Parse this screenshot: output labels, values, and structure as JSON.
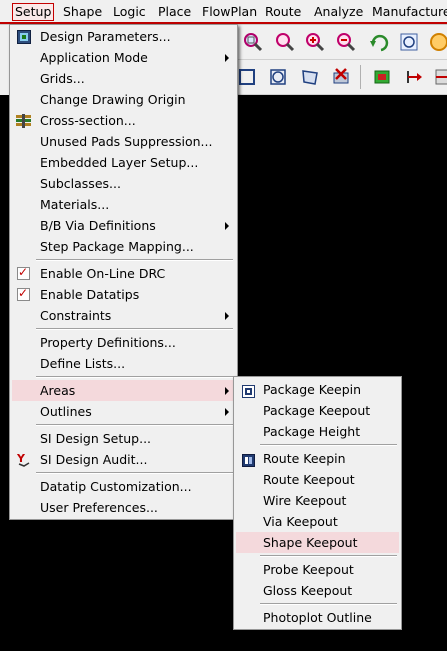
{
  "menubar": {
    "items": [
      "Setup",
      "Shape",
      "Logic",
      "Place",
      "FlowPlan",
      "Route",
      "Analyze",
      "Manufacture"
    ]
  },
  "setup_menu": {
    "items": [
      {
        "label": "Design Parameters...",
        "icon": "design-parameters-icon"
      },
      {
        "label": "Application Mode",
        "submenu": true
      },
      {
        "label": "Grids..."
      },
      {
        "label": "Change Drawing Origin"
      },
      {
        "label": "Cross-section...",
        "icon": "cross-section-icon"
      },
      {
        "label": "Unused Pads Suppression..."
      },
      {
        "label": "Embedded Layer Setup..."
      },
      {
        "label": "Subclasses..."
      },
      {
        "label": "Materials..."
      },
      {
        "label": "B/B Via Definitions",
        "submenu": true
      },
      {
        "label": "Step Package Mapping..."
      },
      {
        "label": "Enable On-Line DRC",
        "checked": true
      },
      {
        "label": "Enable Datatips",
        "checked": true
      },
      {
        "label": "Constraints",
        "submenu": true
      },
      {
        "label": "Property Definitions..."
      },
      {
        "label": "Define Lists..."
      },
      {
        "label": "Areas",
        "submenu": true,
        "highlighted": true
      },
      {
        "label": "Outlines",
        "submenu": true
      },
      {
        "label": "SI Design Setup..."
      },
      {
        "label": "SI Design Audit...",
        "icon": "si-audit-icon"
      },
      {
        "label": "Datatip Customization..."
      },
      {
        "label": "User Preferences..."
      }
    ]
  },
  "areas_menu": {
    "items": [
      {
        "label": "Package Keepin",
        "icon": "package-keepin-icon"
      },
      {
        "label": "Package Keepout"
      },
      {
        "label": "Package Height"
      },
      {
        "label": "Route Keepin",
        "icon": "route-keepin-icon"
      },
      {
        "label": "Route Keepout"
      },
      {
        "label": "Wire Keepout"
      },
      {
        "label": "Via Keepout"
      },
      {
        "label": "Shape Keepout",
        "highlighted": true
      },
      {
        "label": "Probe Keepout"
      },
      {
        "label": "Gloss Keepout"
      },
      {
        "label": "Photoplot Outline"
      }
    ]
  },
  "colors": {
    "highlight": "#f4d9dc",
    "active_menu_border": "#c40000",
    "canvas": "#000000"
  }
}
